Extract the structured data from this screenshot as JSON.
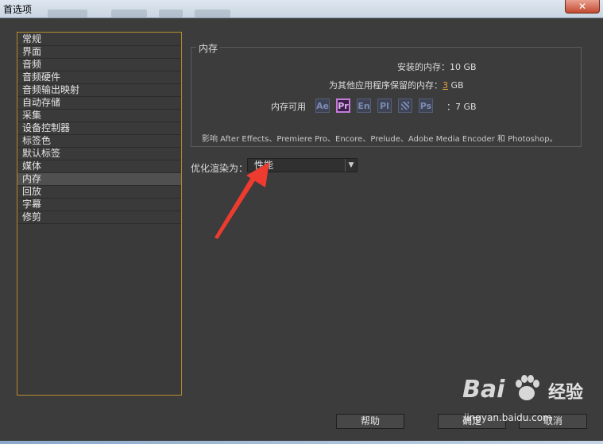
{
  "window": {
    "title": "首选项",
    "close_glyph": "✕"
  },
  "sidebar": {
    "items": [
      {
        "label": "常规"
      },
      {
        "label": "界面"
      },
      {
        "label": "音频"
      },
      {
        "label": "音频硬件"
      },
      {
        "label": "音频输出映射"
      },
      {
        "label": "自动存储"
      },
      {
        "label": "采集"
      },
      {
        "label": "设备控制器"
      },
      {
        "label": "标签色"
      },
      {
        "label": "默认标签"
      },
      {
        "label": "媒体"
      },
      {
        "label": "内存",
        "selected": true
      },
      {
        "label": "回放"
      },
      {
        "label": "字幕"
      },
      {
        "label": "修剪"
      }
    ]
  },
  "memory": {
    "group_title": "内存",
    "installed_label": "安装的内存：",
    "installed_value": "10 GB",
    "reserved_label": "为其他应用程序保留的内存：",
    "reserved_value": "3",
    "reserved_unit": "GB",
    "available_label": "内存可用",
    "available_value": "：7 GB",
    "apps": [
      {
        "abbr": "Ae",
        "icon": "after-effects-icon"
      },
      {
        "abbr": "Pr",
        "icon": "premiere-pro-icon",
        "active": true
      },
      {
        "abbr": "En",
        "icon": "encore-icon"
      },
      {
        "abbr": "Pl",
        "icon": "prelude-icon"
      },
      {
        "abbr": "",
        "icon": "media-encoder-icon"
      },
      {
        "abbr": "Ps",
        "icon": "photoshop-icon"
      }
    ],
    "note": "影响 After Effects、Premiere Pro、Encore、Prelude、Adobe Media Encoder 和 Photoshop。"
  },
  "render": {
    "label": "优化渲染为：",
    "selected": "性能"
  },
  "buttons": {
    "help": "帮助",
    "ok": "确定",
    "cancel": "取消"
  },
  "watermark": {
    "logo": "Bai",
    "brand": "经验",
    "url": "jingyan.baidu.com"
  },
  "colors": {
    "accent": "#e8a33a",
    "sidebar_border": "#b88a2c",
    "annotation": "#ee3b2f",
    "active_app": "#c57bd9"
  }
}
